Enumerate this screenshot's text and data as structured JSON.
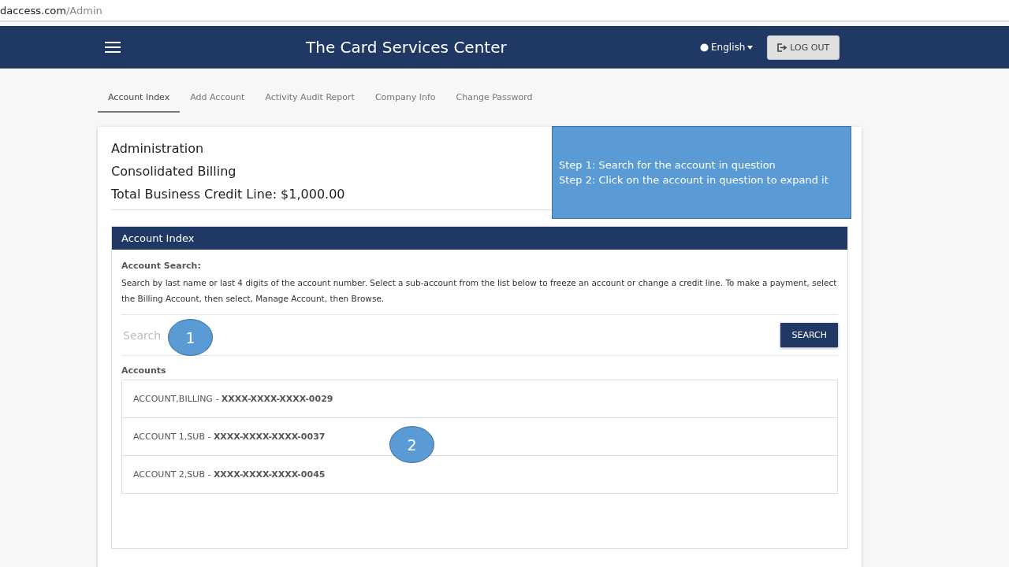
{
  "address_bar": {
    "domain": "daccess.com",
    "path": "/Admin"
  },
  "header": {
    "title": "The Card Services Center",
    "language": "English",
    "logout": "LOG OUT"
  },
  "tabs": [
    {
      "label": "Account Index",
      "selected": true
    },
    {
      "label": "Add Account",
      "selected": false
    },
    {
      "label": "Activity Audit Report",
      "selected": false
    },
    {
      "label": "Company Info",
      "selected": false
    },
    {
      "label": "Change Password",
      "selected": false
    }
  ],
  "summary": [
    "Administration",
    "Consolidated Billing",
    "Total Business Credit Line: $1,000.00"
  ],
  "callout_box": [
    "Step 1: Search for the account in question",
    "Step 2: Click on the account in question to expand it"
  ],
  "panel": {
    "title": "Account Index",
    "search_heading": "Account Search:",
    "search_help": "Search by last name or last 4 digits of the account number. Select a sub-account from the list below to freeze an account or change a credit line. To make a payment, select the Billing Account, then select, Manage Account, then Browse.",
    "search_placeholder": "Search",
    "search_button": "SEARCH",
    "accounts_heading": "Accounts",
    "accounts": [
      "ACCOUNT,BILLING - **XXXX-XXXX-XXXX-0029**",
      "ACCOUNT 1,SUB - **XXXX-XXXX-XXXX-0037**",
      "ACCOUNT 2,SUB - **XXXX-XXXX-XXXX-0045**"
    ]
  },
  "step_markers": [
    "1",
    "2"
  ]
}
